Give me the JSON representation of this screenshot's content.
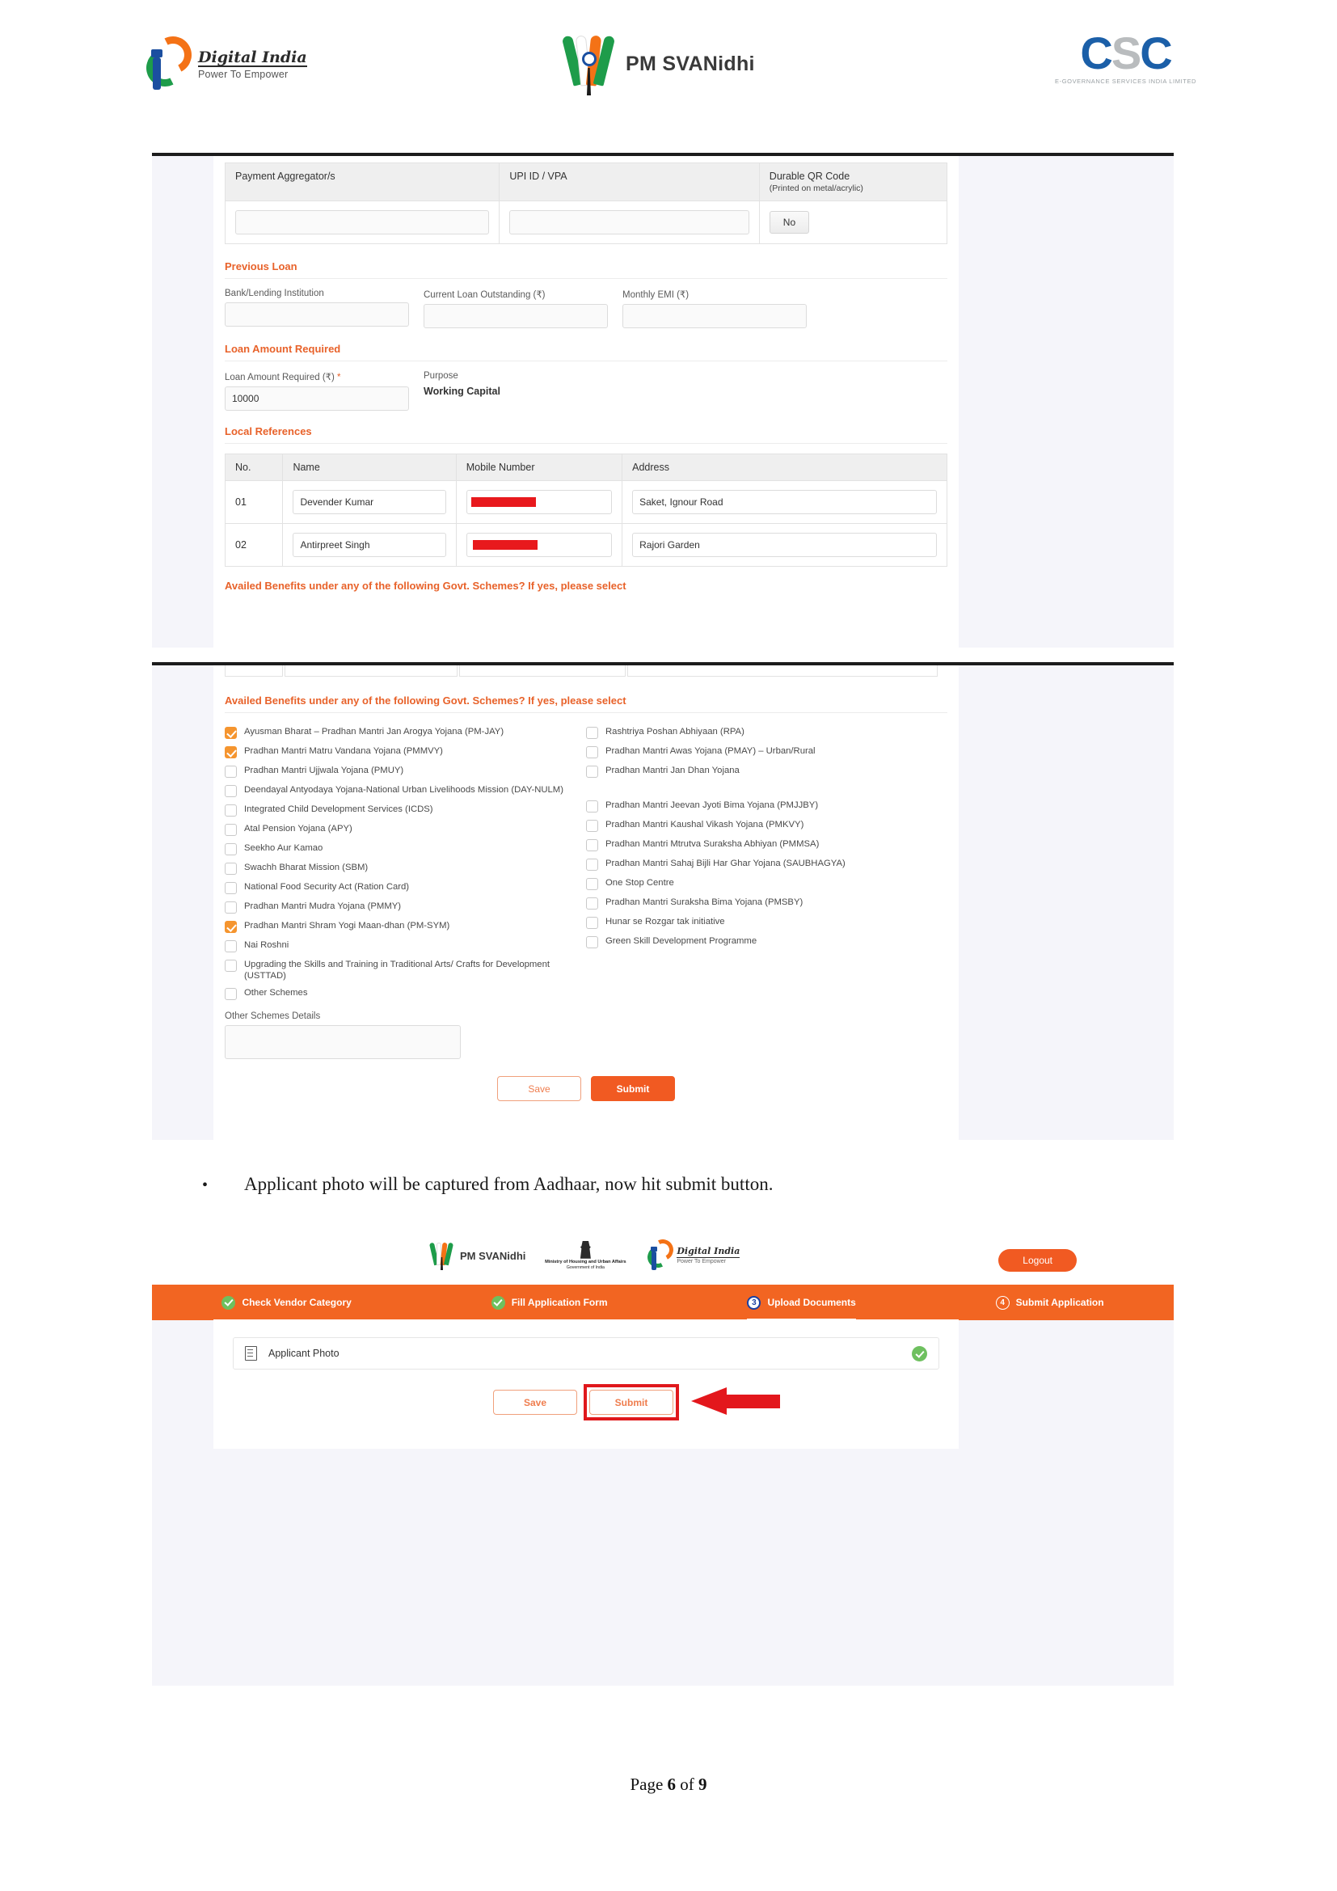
{
  "doc_header": {
    "digital_india": {
      "name": "Digital India",
      "tagline": "Power To Empower"
    },
    "svanidhi": {
      "title": "PM SVANidhi"
    },
    "csc": {
      "letters_1": "C",
      "letters_2": "S",
      "letters_3": "C",
      "tagline": "e-Governance Services India Limited"
    }
  },
  "shot1": {
    "bank_table": {
      "headers": {
        "payment_aggregator": "Payment Aggregator/s",
        "upi_id": "UPI ID / VPA",
        "qr_code": "Durable QR Code",
        "qr_code_sub": "(Printed on metal/acrylic)"
      },
      "payment_aggregator_value": "",
      "upi_id_value": "",
      "qr_code_value": "No"
    },
    "previous_loan": {
      "heading": "Previous Loan",
      "fields": [
        {
          "label": "Bank/Lending Institution",
          "value": ""
        },
        {
          "label": "Current Loan Outstanding (₹)",
          "value": ""
        },
        {
          "label": "Monthly EMI (₹)",
          "value": ""
        }
      ]
    },
    "loan_amount": {
      "heading": "Loan Amount Required",
      "amount_label": "Loan Amount Required (₹)",
      "amount_required_marker": "*",
      "amount_value": "10000",
      "purpose_label": "Purpose",
      "purpose_value": "Working Capital"
    },
    "local_references": {
      "heading": "Local References",
      "columns": [
        "No.",
        "Name",
        "Mobile Number",
        "Address"
      ],
      "rows": [
        {
          "no": "01",
          "name": "Devender Kumar",
          "mobile": "",
          "mobile_redacted": true,
          "address": "Saket, Ignour Road"
        },
        {
          "no": "02",
          "name": "Antirpreet Singh",
          "mobile": "",
          "mobile_redacted": true,
          "address": "Rajori Garden"
        }
      ]
    },
    "schemes_heading": "Availed Benefits under any of the following Govt. Schemes? If yes, please select"
  },
  "shot2": {
    "schemes_heading": "Availed Benefits under any of the following Govt. Schemes? If yes, please select",
    "schemes_left": [
      {
        "label": "Ayusman Bharat – Pradhan Mantri Jan Arogya Yojana (PM-JAY)",
        "checked": true
      },
      {
        "label": "Pradhan Mantri Matru Vandana Yojana (PMMVY)",
        "checked": true
      },
      {
        "label": "Pradhan Mantri Ujjwala Yojana (PMUY)",
        "checked": false
      },
      {
        "label": "Deendayal Antyodaya Yojana-National Urban Livelihoods Mission (DAY-NULM)",
        "checked": false
      },
      {
        "label": "Integrated Child Development Services (ICDS)",
        "checked": false
      },
      {
        "label": "Atal Pension Yojana (APY)",
        "checked": false
      },
      {
        "label": "Seekho Aur Kamao",
        "checked": false
      },
      {
        "label": "Swachh Bharat Mission (SBM)",
        "checked": false
      },
      {
        "label": "National Food Security Act (Ration Card)",
        "checked": false
      },
      {
        "label": "Pradhan Mantri Mudra Yojana (PMMY)",
        "checked": false
      },
      {
        "label": "Pradhan Mantri Shram Yogi Maan-dhan (PM-SYM)",
        "checked": true
      },
      {
        "label": "Nai Roshni",
        "checked": false
      },
      {
        "label": "Upgrading the Skills and Training in Traditional Arts/ Crafts for Development (USTTAD)",
        "checked": false
      },
      {
        "label": "Other Schemes",
        "checked": false
      }
    ],
    "schemes_right": [
      {
        "label": "Rashtriya Poshan Abhiyaan (RPA)",
        "checked": false
      },
      {
        "label": "Pradhan Mantri Awas Yojana (PMAY) – Urban/Rural",
        "checked": false
      },
      {
        "label": "Pradhan Mantri Jan Dhan Yojana",
        "checked": false
      },
      {
        "label": "",
        "checked": false,
        "spacer": true
      },
      {
        "label": "Pradhan Mantri Jeevan Jyoti Bima Yojana (PMJJBY)",
        "checked": false
      },
      {
        "label": "Pradhan Mantri Kaushal Vikash Yojana (PMKVY)",
        "checked": false
      },
      {
        "label": "Pradhan Mantri Mtrutva Suraksha Abhiyan (PMMSA)",
        "checked": false
      },
      {
        "label": "Pradhan Mantri Sahaj Bijli Har Ghar Yojana (SAUBHAGYA)",
        "checked": false
      },
      {
        "label": "One Stop Centre",
        "checked": false
      },
      {
        "label": "Pradhan Mantri Suraksha Bima Yojana (PMSBY)",
        "checked": false
      },
      {
        "label": "Hunar se Rozgar tak initiative",
        "checked": false
      },
      {
        "label": "Green Skill Development Programme",
        "checked": false
      }
    ],
    "other_schemes_label": "Other Schemes Details",
    "other_schemes_value": "",
    "save_label": "Save",
    "submit_label": "Submit"
  },
  "instruction": {
    "bullet": "•",
    "text": "Applicant photo will be captured from Aadhaar, now hit submit button."
  },
  "shot3": {
    "svanidhi_title": "PM SVANidhi",
    "ministry": {
      "line1": "Ministry of Housing and Urban Affairs",
      "line2": "Government of India"
    },
    "digital_india": {
      "name": "Digital India",
      "tagline": "Power To Empower"
    },
    "logout_label": "Logout",
    "steps": [
      {
        "label": "Check Vendor Category",
        "state": "done",
        "badge": ""
      },
      {
        "label": "Fill Application Form",
        "state": "done",
        "badge": ""
      },
      {
        "label": "Upload Documents",
        "state": "current",
        "badge": "3"
      },
      {
        "label": "Submit Application",
        "state": "todo",
        "badge": "4"
      }
    ],
    "document_row": {
      "label": "Applicant Photo",
      "status": "uploaded"
    },
    "save_label": "Save",
    "submit_label": "Submit"
  },
  "footer": {
    "prefix": "Page ",
    "page": "6",
    "middle": " of ",
    "total": "9"
  },
  "colors": {
    "brand_orange": "#f15a22",
    "step_bar": "#f26522",
    "section_heading": "#e8622a",
    "checkbox_on": "#f5952f",
    "highlight_red": "#e0181c",
    "success_green": "#6ec05f"
  }
}
